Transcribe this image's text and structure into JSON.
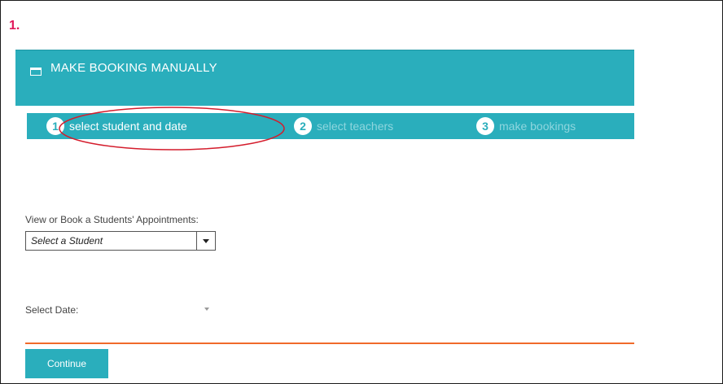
{
  "annotation": {
    "step_marker": "1."
  },
  "panel": {
    "title": "MAKE BOOKING MANUALLY",
    "icon": "calendar-icon",
    "color": "#2aaebc"
  },
  "steps": [
    {
      "number": "2",
      "label": "select teachers",
      "active": false
    },
    {
      "number": "3",
      "label": "make bookings",
      "active": false
    },
    {
      "number": "1",
      "label": "select student and date",
      "active": true
    }
  ],
  "form": {
    "student_label": "View or Book a Students' Appointments:",
    "student_select_value": "Select a Student",
    "date_label": "Select Date:",
    "date_value": ""
  },
  "actions": {
    "continue_label": "Continue"
  },
  "colors": {
    "accent": "#2aaebc",
    "divider": "#f06a2a",
    "annotation": "#e0185a",
    "highlight_ellipse": "#d41c2c"
  }
}
